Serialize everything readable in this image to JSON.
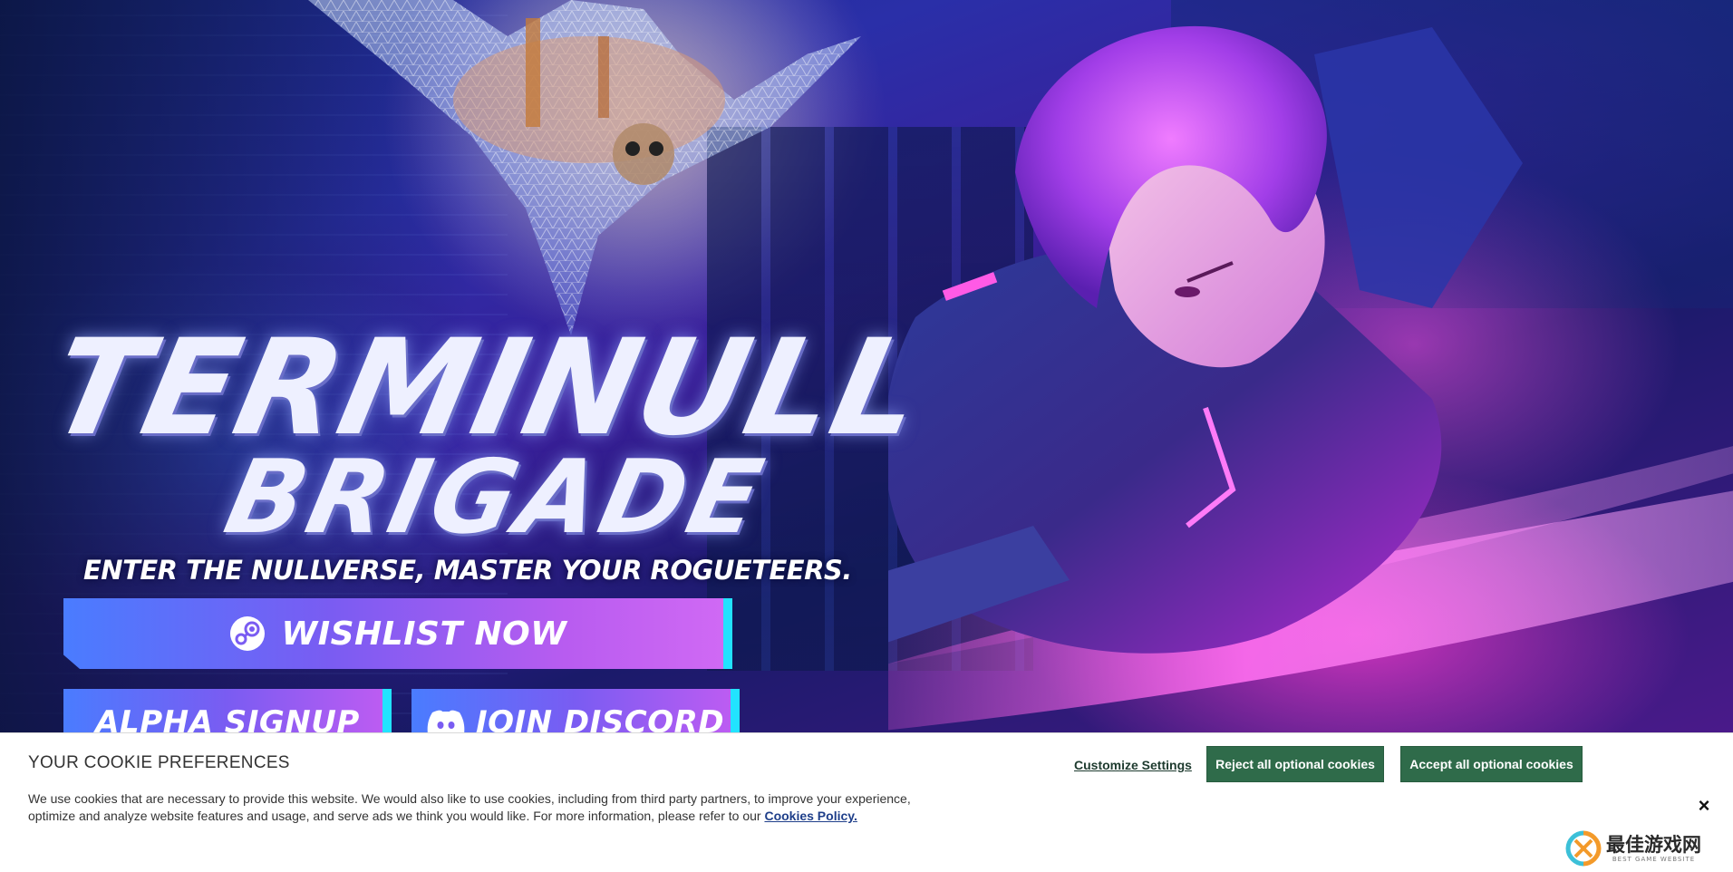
{
  "hero": {
    "logo_line1": "TERMINULL",
    "logo_line2": "BRIGADE",
    "tagline": "ENTER THE NULLVERSE, MASTER YOUR ROGUETEERS.",
    "wishlist_label": "WISHLIST NOW",
    "alpha_label": "ALPHA SIGNUP",
    "discord_label": "JOIN DISCORD",
    "accent_color": "#22e3ff"
  },
  "cookie": {
    "title": "YOUR COOKIE PREFERENCES",
    "text_line1": "We use cookies that are necessary to provide this website. We would also like to use cookies, including from third party partners, to improve your experience,",
    "text_line2": "optimize and analyze website features and usage, and serve ads we think you would like. For more information, please refer to our",
    "policy_link": "Cookies Policy.",
    "customize_label": "Customize Settings",
    "reject_label": "Reject all optional cookies",
    "accept_label": "Accept all optional cookies",
    "close_label": "×",
    "button_color": "#2f6b4a"
  },
  "watermark": {
    "cn": "最佳游戏网",
    "en": "BEST GAME WEBSITE"
  }
}
